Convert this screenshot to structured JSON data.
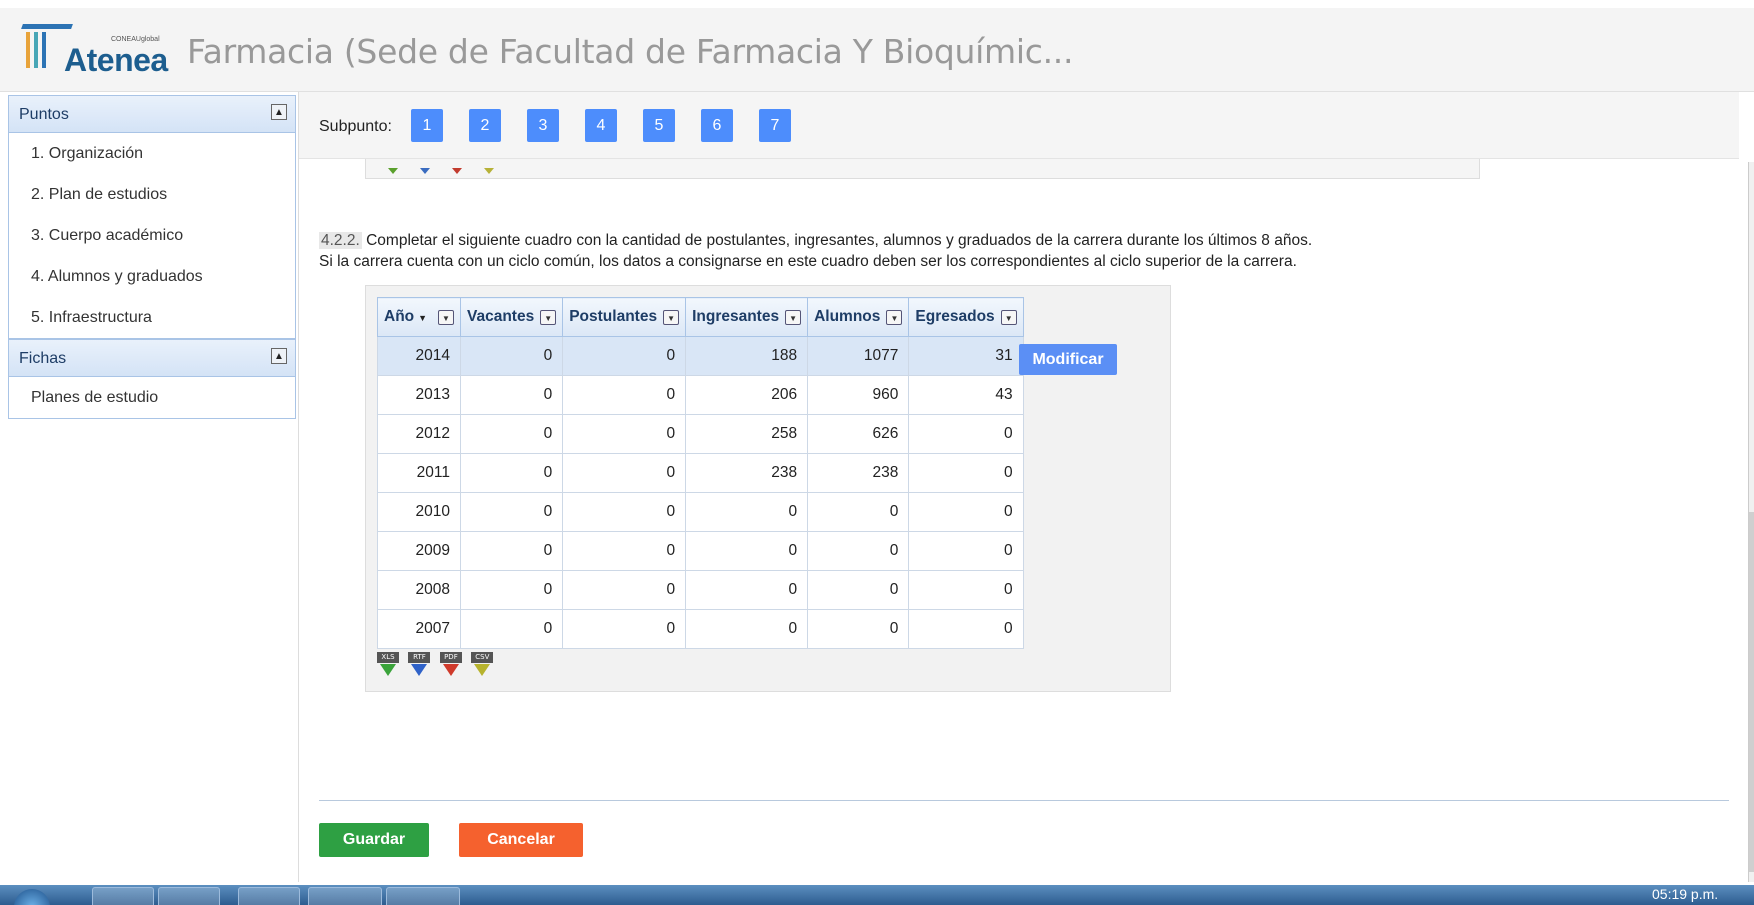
{
  "header": {
    "logo_small": "CONEAUglobal",
    "logo_text": "Atenea",
    "title": "Farmacia (Sede de Facultad de Farmacia Y Bioquímic..."
  },
  "sidebar": {
    "puntos": {
      "title": "Puntos",
      "items": [
        "1. Organización",
        "2. Plan de estudios",
        "3. Cuerpo académico",
        "4. Alumnos y graduados",
        "5. Infraestructura"
      ]
    },
    "fichas": {
      "title": "Fichas",
      "items": [
        "Planes de estudio"
      ]
    }
  },
  "subpunto": {
    "label": "Subpunto:",
    "buttons": [
      "1",
      "2",
      "3",
      "4",
      "5",
      "6",
      "7"
    ]
  },
  "question": {
    "number": "4.2.2.",
    "line1": "Completar el siguiente cuadro con la cantidad de postulantes, ingresantes, alumnos y graduados de la carrera durante los últimos 8 años.",
    "line2": "Si la carrera cuenta con un ciclo común, los datos a consignarse en este cuadro deben ser los correspondientes al ciclo superior de la carrera."
  },
  "table": {
    "headers": [
      "Año",
      "Vacantes",
      "Postulantes",
      "Ingresantes",
      "Alumnos",
      "Egresados"
    ],
    "rows": [
      [
        "2014",
        "0",
        "0",
        "188",
        "1077",
        "31"
      ],
      [
        "2013",
        "0",
        "0",
        "206",
        "960",
        "43"
      ],
      [
        "2012",
        "0",
        "0",
        "258",
        "626",
        "0"
      ],
      [
        "2011",
        "0",
        "0",
        "238",
        "238",
        "0"
      ],
      [
        "2010",
        "0",
        "0",
        "0",
        "0",
        "0"
      ],
      [
        "2009",
        "0",
        "0",
        "0",
        "0",
        "0"
      ],
      [
        "2008",
        "0",
        "0",
        "0",
        "0",
        "0"
      ],
      [
        "2007",
        "0",
        "0",
        "0",
        "0",
        "0"
      ]
    ],
    "selected_row": 0
  },
  "export": [
    "XLS",
    "RTF",
    "PDF",
    "CSV"
  ],
  "actions": {
    "modify": "Modificar",
    "save": "Guardar",
    "cancel": "Cancelar"
  },
  "taskbar": {
    "clock": "05:19 p.m."
  },
  "colors": {
    "accent_blue": "#4d8dfc",
    "save_green": "#2ea043",
    "cancel_orange": "#f5612e"
  }
}
